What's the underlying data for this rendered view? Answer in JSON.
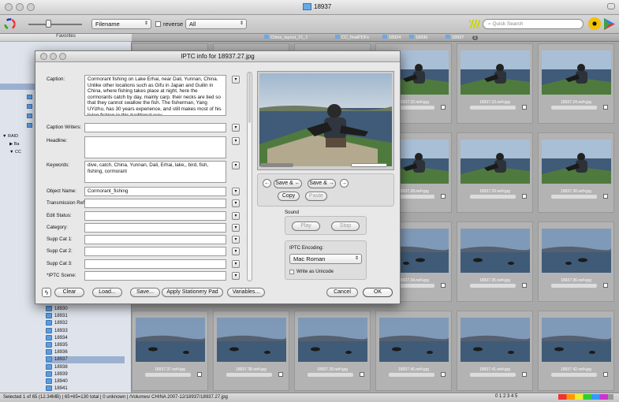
{
  "window": {
    "title": "18937"
  },
  "toolbar": {
    "sort_select": "Filename",
    "reverse_label": "reverse",
    "filter_select": "All",
    "search_placeholder": "Quick Search"
  },
  "sidebar": {
    "header": "Favorites",
    "labels": {
      "raid": "RAID",
      "ba": "Ba",
      "cc": "CC"
    },
    "folders": [
      "18930",
      "18931",
      "18932",
      "18933",
      "18934",
      "18935",
      "18936",
      "18937",
      "18938",
      "18939",
      "18940",
      "18941"
    ],
    "selected": "18937"
  },
  "tabs": [
    "China_layout_21_1",
    "CC_finalPDFs",
    "18924",
    "18936",
    "18937"
  ],
  "tab_badge": "1",
  "grid": {
    "captions": [
      "",
      "",
      "",
      "18937.22.nef+jpg",
      "18937.23.nef+jpg",
      "18937.24.nef+jpg",
      "",
      "",
      "",
      "18937.28.nef+jpg",
      "18937.29.nef+jpg",
      "18937.30.nef+jpg",
      "",
      "",
      "",
      "18937.34.nef+jpg",
      "18937.35.nef+jpg",
      "18937.36.nef+jpg",
      "18937.37.nef+jpg",
      "18937.38.nef+jpg",
      "18937.39.nef+jpg",
      "18937.40.nef+jpg",
      "18937.41.nef+jpg",
      "18937.42.nef+jpg"
    ]
  },
  "status": {
    "text": "Selected 1 of 65 (12.34MB) | 65+65=130 total | 0 unknown | /Volumes/ CHINA 2007-12/18937/18937.27.jpg"
  },
  "pager_text": "0 1 2 3 4 5",
  "dialog": {
    "title": "IPTC info for 18937.27.jpg",
    "fields": {
      "caption": {
        "label": "Caption:",
        "value": "Cormorant fishing on Lake Erhai, near Dali, Yunnan, China. Unlike other locations such as Gifu in Japan and Guilin in China, where fishing takes place at night, here the cormorants catch by day, mainly carp. their necks are tied so that they cannot swallow the fish. The fisherman, Yang UYizhu, has 30 years experience, and still makes most of his living fishing in this traditional way."
      },
      "caption_writers": {
        "label": "Caption Writers:",
        "value": ""
      },
      "headline": {
        "label": "Headline:",
        "value": ""
      },
      "keywords": {
        "label": "Keywords:",
        "value": "dive, catch, China, Yunnan, Dali, Erhai, lake,, bird, fish, fishing, cormorant"
      },
      "object_name": {
        "label": "Object Name:",
        "value": "Cormorant_fishing"
      },
      "transmission_ref": {
        "label": "Transmission Ref:",
        "value": ""
      },
      "edit_status": {
        "label": "Edit Status:",
        "value": ""
      },
      "category": {
        "label": "Category:",
        "value": ""
      },
      "supp_cat_1": {
        "label": "Supp Cat 1:",
        "value": ""
      },
      "supp_cat_2": {
        "label": "Supp Cat 2:",
        "value": ""
      },
      "supp_cat_3": {
        "label": "Supp Cat 3:",
        "value": ""
      },
      "iptc_scene": {
        "label": "*IPTC Scene:",
        "value": ""
      }
    },
    "save_left": "Save & ←",
    "save_right": "Save & →",
    "copy": "Copy",
    "paste": "Paste",
    "sound_label": "Sound",
    "play": "Play",
    "stop": "Stop",
    "encoding_label": "IPTC Encoding:",
    "encoding_value": "Mac Roman",
    "write_unicode": "Write as Unicode",
    "buttons": {
      "clear": "Clear",
      "load": "Load...",
      "save": "Save...",
      "stationery": "Apply Stationery Pad",
      "variables": "Variables...",
      "cancel": "Cancel",
      "ok": "OK"
    }
  },
  "colors": {
    "sky": "#6f8fb5",
    "water": "#3f5b78",
    "boat_green": "#4f7a3e",
    "selection": "#9cb1d1"
  }
}
